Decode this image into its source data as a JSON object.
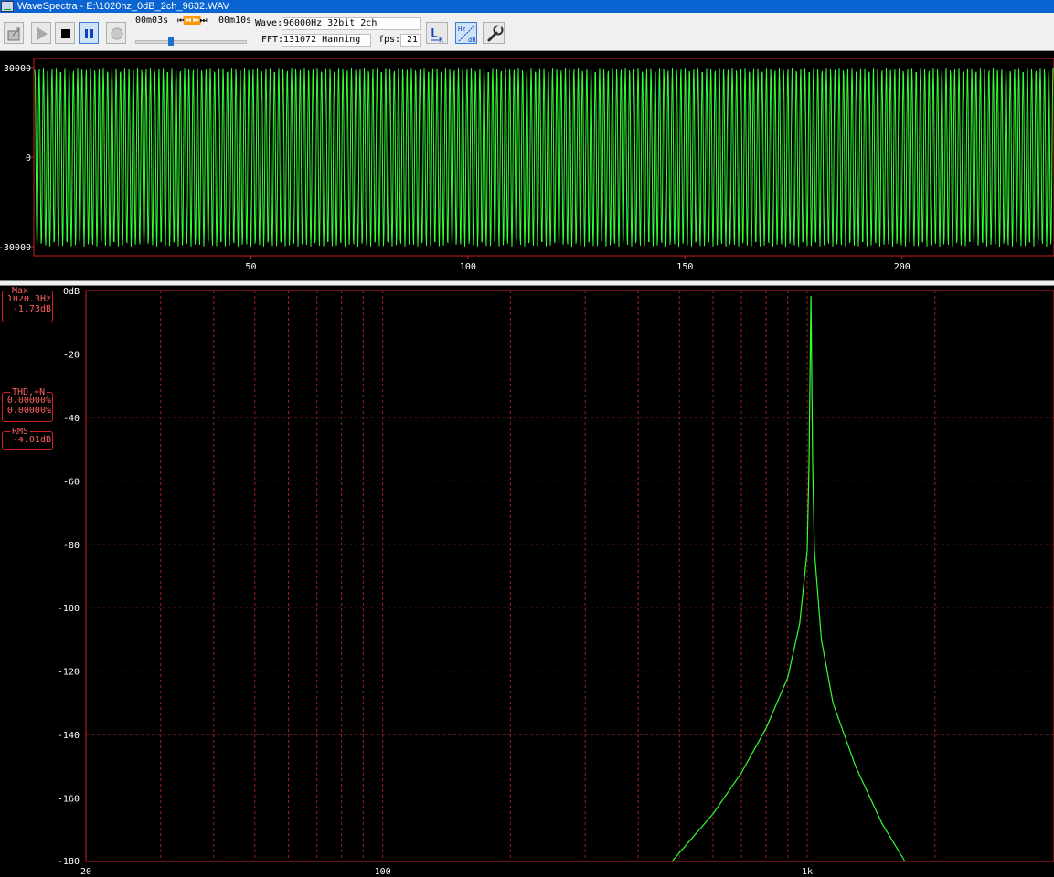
{
  "window": {
    "title": "WaveSpectra - E:\\1020hz_0dB_2ch_9632.WAV"
  },
  "toolbar": {
    "time_current": "00m03s",
    "time_total": "00m10s",
    "transport_glyphs": "⏮⏪⏩⏭",
    "seek_fraction": 0.3,
    "wave_label": "Wave:",
    "wave_value": "96000Hz 32bit 2ch",
    "fft_label": "FFT:",
    "fft_value": "131072 Hanning",
    "fps_label": "fps:",
    "fps_value": "21",
    "buttons": [
      {
        "name": "open-file-button",
        "icon": "open-file-icon"
      },
      {
        "name": "play-button",
        "icon": "play-icon"
      },
      {
        "name": "stop-button",
        "icon": "stop-icon"
      },
      {
        "name": "pause-button",
        "icon": "pause-icon",
        "active": true
      },
      {
        "name": "record-button",
        "icon": "record-icon"
      },
      {
        "name": "channel-lr-button",
        "icon": "channel-lr-icon"
      },
      {
        "name": "hz-db-button",
        "icon": "hz-db-icon"
      },
      {
        "name": "settings-button",
        "icon": "wrench-icon"
      }
    ],
    "lr_labels": [
      "L",
      "R"
    ],
    "hzdb_labels": [
      "Hz",
      "dB"
    ]
  },
  "waveform": {
    "y_ticks": [
      {
        "value": 30000,
        "label": "30000"
      },
      {
        "value": 0,
        "label": "0"
      },
      {
        "value": -30000,
        "label": "-30000"
      }
    ],
    "x_ticks": [
      {
        "value": 50,
        "label": "50"
      },
      {
        "value": 100,
        "label": "100"
      },
      {
        "value": 150,
        "label": "150"
      },
      {
        "value": 200,
        "label": "200"
      }
    ],
    "trace_color": "#33ff33",
    "border_color": "#cc2222"
  },
  "spectrum": {
    "y_ticks": [
      {
        "value": 0,
        "label": "0dB"
      },
      {
        "value": -20,
        "label": "-20"
      },
      {
        "value": -40,
        "label": "-40"
      },
      {
        "value": -60,
        "label": "-60"
      },
      {
        "value": -80,
        "label": "-80"
      },
      {
        "value": -100,
        "label": "-100"
      },
      {
        "value": -120,
        "label": "-120"
      },
      {
        "value": -140,
        "label": "-140"
      },
      {
        "value": -160,
        "label": "-160"
      },
      {
        "value": -180,
        "label": "-180"
      }
    ],
    "x_ticks": [
      {
        "value": 20,
        "label": "20"
      },
      {
        "value": 100,
        "label": "100"
      },
      {
        "value": 1000,
        "label": "1k"
      }
    ],
    "grid_color": "#a02020",
    "trace_color": "#33ff33",
    "readouts": {
      "max": {
        "title": "Max",
        "values": [
          "1020.3Hz",
          "-1.73dB"
        ]
      },
      "thd": {
        "title": "THD,+N",
        "values": [
          "0.00000%",
          "0.00000%"
        ]
      },
      "rms": {
        "title": "RMS",
        "values": [
          "-4.01dB"
        ]
      }
    }
  },
  "chart_data": [
    {
      "type": "line",
      "x": [
        0,
        235
      ],
      "ylim": [
        -30000,
        30000
      ],
      "xlim": [
        0,
        235
      ],
      "series": [
        {
          "values": [
            30000,
            -30000
          ]
        }
      ],
      "grid": false
    },
    {
      "type": "line",
      "x": [
        480,
        600,
        700,
        800,
        900,
        960,
        1000,
        1010,
        1020.3,
        1030,
        1040,
        1080,
        1150,
        1300,
        1500,
        1700
      ],
      "ylim": [
        -180,
        0
      ],
      "xlim": [
        20,
        2300
      ],
      "xscale": "log",
      "series": [
        {
          "values": [
            -180,
            -165,
            -152,
            -138,
            -122,
            -105,
            -82,
            -55,
            -1.73,
            -55,
            -82,
            -110,
            -130,
            -150,
            -168,
            -180
          ]
        }
      ],
      "grid": true
    }
  ]
}
